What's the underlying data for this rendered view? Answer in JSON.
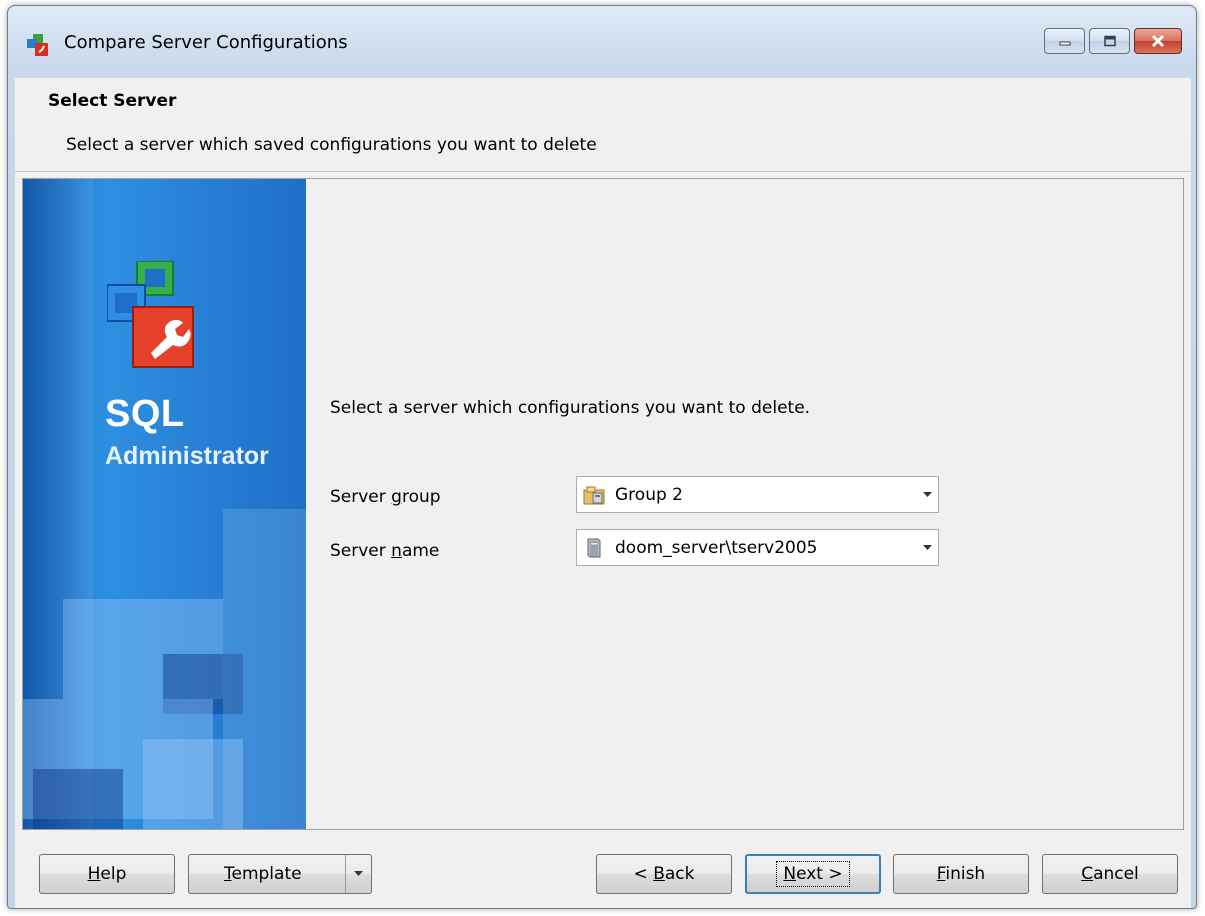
{
  "window": {
    "title": "Compare Server Configurations"
  },
  "header": {
    "title": "Select Server",
    "description": "Select a server which saved configurations you want to delete"
  },
  "banner": {
    "line1": "SQL",
    "line2": "Administrator"
  },
  "main": {
    "prompt": "Select a server which configurations you want to delete.",
    "server_group": {
      "label_pre": "Server ",
      "label_accel": "g",
      "label_post": "roup",
      "value": "Group 2",
      "icon": "folder-group-icon"
    },
    "server_name": {
      "label_pre": "Server ",
      "label_accel": "n",
      "label_post": "ame",
      "value": "doom_server\\tserv2005",
      "icon": "server-icon"
    }
  },
  "footer": {
    "help": {
      "accel": "H",
      "rest": "elp"
    },
    "template": {
      "accel": "T",
      "rest": "emplate"
    },
    "back": {
      "pre": "< ",
      "accel": "B",
      "rest": "ack"
    },
    "next": {
      "accel": "N",
      "rest": "ext >"
    },
    "finish": {
      "accel": "F",
      "rest": "inish"
    },
    "cancel": {
      "accel": "C",
      "rest": "ancel"
    }
  }
}
